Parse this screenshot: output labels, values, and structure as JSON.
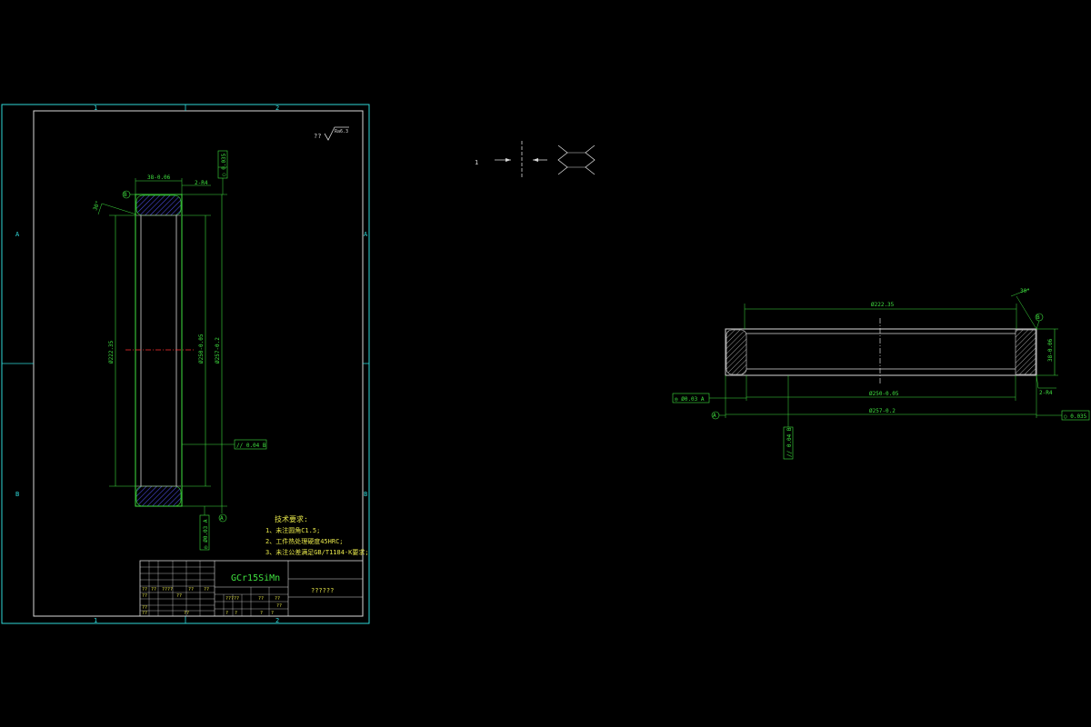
{
  "colors": {
    "background": "#000000",
    "frame": "#2fd8d8",
    "geometry": "#d8d8d8",
    "dimension": "#3fe03f",
    "text": "#e6e64a",
    "centerline": "#ff3030"
  },
  "frame": {
    "col_top_1": "1",
    "col_top_2": "2",
    "col_bottom_1": "1",
    "col_bottom_2": "2",
    "row_left_a": "A",
    "row_left_b": "B",
    "row_right_a": "A",
    "row_right_b": "B"
  },
  "roughness": {
    "symbol": "??",
    "text": "Ra6.3"
  },
  "section_view": {
    "width_dim": "38-0.06",
    "chamfer": "2-R4",
    "angle": "30°",
    "datum_b": "B",
    "datum_a": "A",
    "inner_dia": "Ø222.35",
    "bore_dia": "Ø250-0.05",
    "outer_dia": "Ø257-0.2",
    "parallel_tol": "// 0.04 B",
    "concentric_tol": "◎ Ø0.03 A",
    "round_tol": "○ 0.035"
  },
  "tech_requirements": {
    "title": "技术要求:",
    "items": [
      "1、未注圆角C1.5;",
      "2、工件热处理硬度45HRC;",
      "3、未注公差满足GB/T1184-K要求;"
    ]
  },
  "title_block": {
    "material": "GCr15SiMn",
    "name": "??????",
    "small_labels": [
      "??",
      "??",
      "????",
      "??",
      "??",
      "??",
      "??",
      "??",
      "?????",
      "??",
      "??",
      "??",
      "?",
      "?",
      "?",
      "?",
      "??",
      "??"
    ]
  },
  "symbol": {
    "label": "1"
  },
  "side_view": {
    "top_dim": "Ø222.35",
    "angle": "30°",
    "datum_b": "B",
    "height_dim": "38-0.06",
    "concentric_tol": "◎ Ø0.03 A",
    "bore_dim": "Ø250-0.05",
    "chamfer": "2-R4",
    "datum_a": "A",
    "outer_dim": "Ø257-0.2",
    "round_tol": "○ 0.035",
    "parallel_tol": "// 0.04 B"
  }
}
